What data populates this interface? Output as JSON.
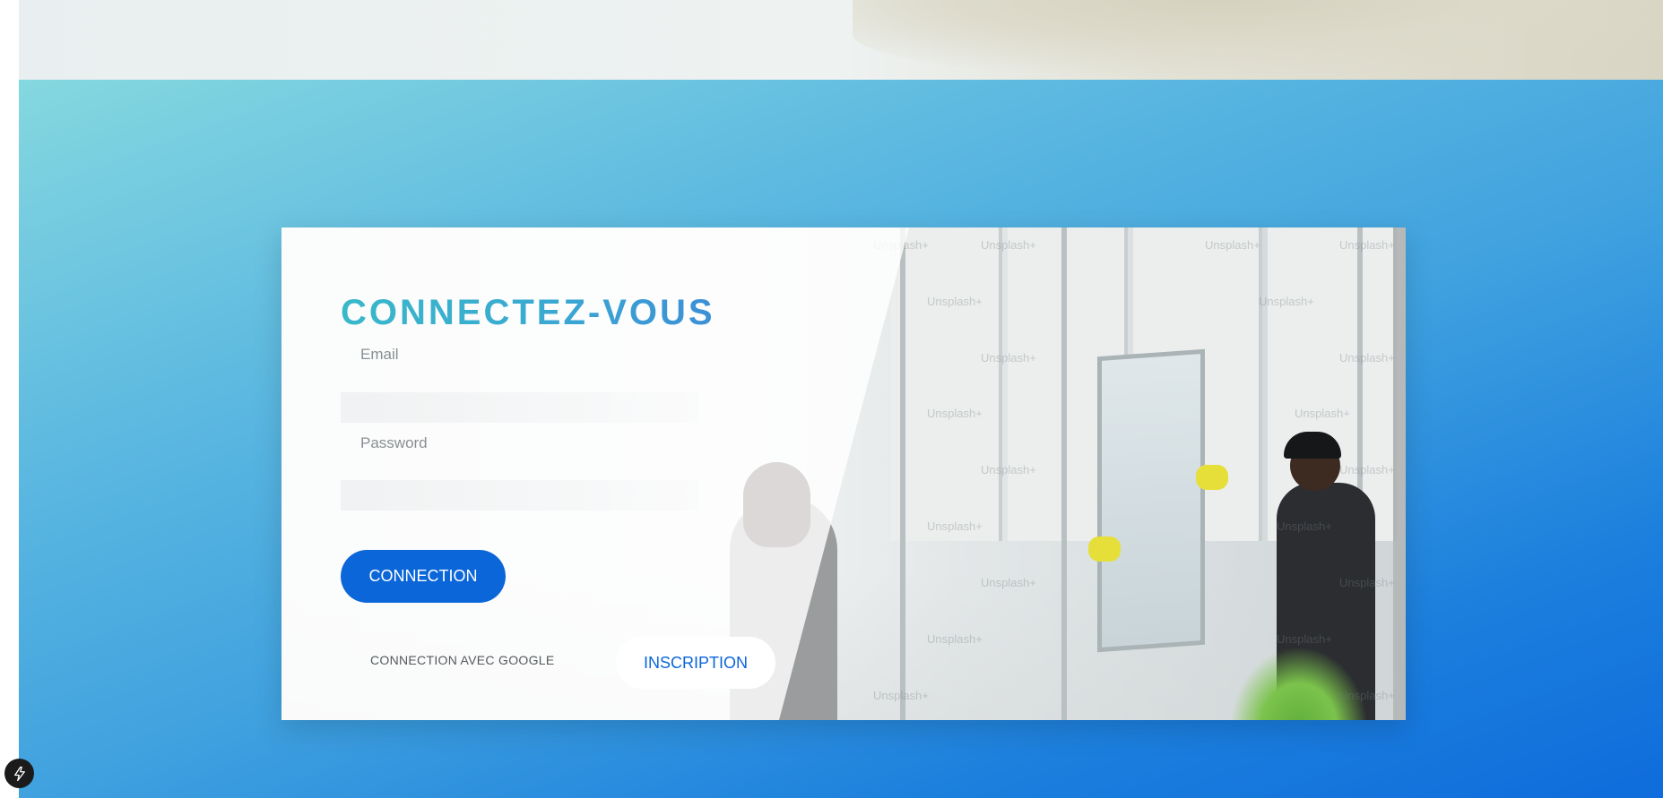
{
  "login": {
    "title": "CONNECTEZ-VOUS",
    "email_placeholder": "Email",
    "password_placeholder": "Password",
    "connect_button": "CONNECTION",
    "google_link": "CONNECTION AVEC GOOGLE",
    "signup_button": "INSCRIPTION"
  },
  "photo": {
    "watermark_text": "Unsplash+"
  },
  "colors": {
    "primary": "#0a66d9",
    "title_gradient_start": "#39b8c9",
    "title_gradient_end": "#3c8fd6",
    "background_gradient_start": "#85d8df",
    "background_gradient_end": "#0f6cdc"
  },
  "icons": {
    "badge": "bolt-icon"
  }
}
